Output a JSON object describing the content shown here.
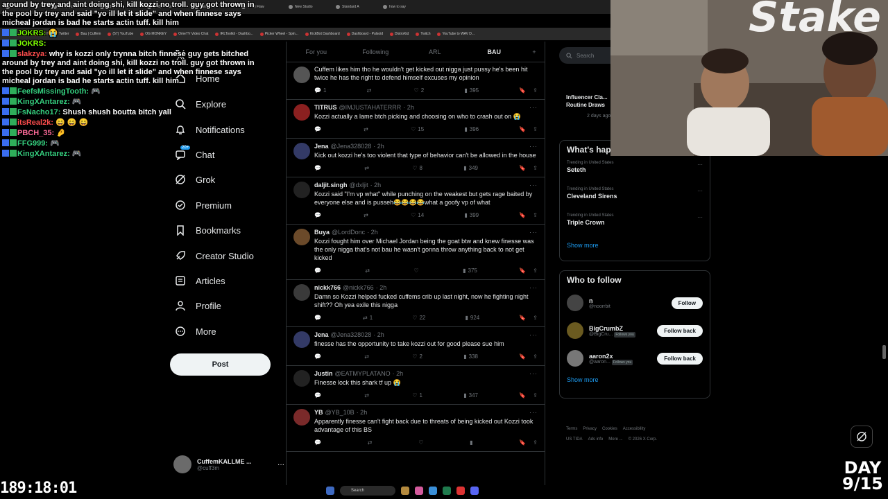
{
  "browser": {
    "tabs": [
      "IRLToolkit",
      "(439) ryzen",
      "(439) KickC",
      "(958) FREE",
      "konvy aunt",
      "(958) Flaw",
      "New Studio",
      "Standard A",
      "how to say"
    ],
    "bookmarks": [
      "(12) Home / Twitter",
      "Bau | Cuffem",
      "(57) YouTube",
      "OG MONKEY",
      "OmeTV Video Chat",
      "IRLToolkit - Dashbo...",
      "Picker Wheel - Spin...",
      "KickBot Dashboard",
      "Dashboard - Pulsoid",
      "DistroKid",
      "Twitch",
      "YouTube to WAV D..."
    ]
  },
  "chat": [
    {
      "user": "",
      "text": "around by trey and aint doing shi, kill kozzi no troll. guy got thrown in the pool by trey and said \"yo ill let it slide\" and when finnese says micheal jordan is bad he starts actin tuff. kill him"
    },
    {
      "user": "JOKRS:",
      "text": "😭"
    },
    {
      "user": "JOKRS:",
      "text": ""
    },
    {
      "user": "slakzya:",
      "text": "why is kozzi only trynna bitch finnese guy gets bitched around by trey and aint doing shi, kill kozzi no troll. guy got thrown in the pool by trey and said \"yo ill let it slide\" and when finnese says micheal jordan is bad he starts actin tuff. kill him"
    },
    {
      "user": "FeefsMissingTooth:",
      "text": "🎮"
    },
    {
      "user": "KingXAntarez:",
      "text": "🎮"
    },
    {
      "user": "FsNacho17:",
      "text": "Shush shush boutta bitch yall"
    },
    {
      "user": "itsReal2k:",
      "text": "😄 😄 😄"
    },
    {
      "user": "PBCH_35:",
      "text": "🤌"
    },
    {
      "user": "FFG999:",
      "text": "🎮"
    },
    {
      "user": "KingXAntarez:",
      "text": "🎮"
    }
  ],
  "nav": {
    "items": [
      {
        "label": "Home",
        "icon": "home-icon"
      },
      {
        "label": "Explore",
        "icon": "search-icon"
      },
      {
        "label": "Notifications",
        "icon": "bell-icon"
      },
      {
        "label": "Chat",
        "icon": "chat-icon",
        "badge": "20+"
      },
      {
        "label": "Grok",
        "icon": "grok-icon"
      },
      {
        "label": "Premium",
        "icon": "premium-icon"
      },
      {
        "label": "Bookmarks",
        "icon": "bookmark-icon"
      },
      {
        "label": "Creator Studio",
        "icon": "rocket-icon"
      },
      {
        "label": "Articles",
        "icon": "article-icon"
      },
      {
        "label": "Profile",
        "icon": "person-icon"
      },
      {
        "label": "More",
        "icon": "more-icon"
      }
    ],
    "post_label": "Post",
    "account": {
      "name": "CuffemKALLME ...",
      "handle": "@cuff3m"
    }
  },
  "feed": {
    "tabs": [
      "For you",
      "Following",
      "ARL",
      "BAU"
    ],
    "active_tab": "BAU",
    "tweets": [
      {
        "name": "",
        "handle": "",
        "time": "",
        "text": "Cuffem likes him tho he wouldn't get kicked out nigga just pussy he's been hit twice he has the right to defend himself excuses my opinion",
        "replies": "1",
        "reposts": "",
        "likes": "2",
        "views": "395"
      },
      {
        "name": "TITRUS",
        "handle": "@IMJUSTAHATERRR",
        "time": "· 2h",
        "text": "Kozzi actually a lame btch picking and choosing on who to crash out on 😭",
        "replies": "",
        "reposts": "",
        "likes": "15",
        "views": "396"
      },
      {
        "name": "Jena",
        "handle": "@Jena328028",
        "time": "· 2h",
        "text": "Kick out kozzi he's too violent that type of behavior can't be allowed in the house",
        "replies": "",
        "reposts": "",
        "likes": "8",
        "views": "349"
      },
      {
        "name": "daljit.singh",
        "handle": "@dxljit",
        "time": "· 2h",
        "text": "Kozzi said \"I'm vp what\" while punching on the weakest but gets rage baited by everyone else and is pusseh😂😂😂😂what a goofy vp of what",
        "replies": "",
        "reposts": "",
        "likes": "14",
        "views": "399"
      },
      {
        "name": "Buya",
        "handle": "@LordDonc",
        "time": "· 2h",
        "text": "Kozzi fought him over Michael Jordan being the goat btw and knew finesse was the only nigga that's not bau he wasn't gonna throw anything back to not get kicked",
        "replies": "",
        "reposts": "",
        "likes": "",
        "views": "375"
      },
      {
        "name": "nickk766",
        "handle": "@nickk766",
        "time": "· 2h",
        "text": "Damn so Kozzi helped fucked cuffems crib up last night, now he fighting night shift?? Oh yea exile this nigga",
        "replies": "",
        "reposts": "1",
        "likes": "22",
        "views": "924"
      },
      {
        "name": "Jena",
        "handle": "@Jena328028",
        "time": "· 2h",
        "text": "finesse has the opportunity to take kozzi out for good please sue him",
        "replies": "",
        "reposts": "",
        "likes": "2",
        "views": "338"
      },
      {
        "name": "Justin",
        "handle": "@EATMYPLATANO",
        "time": "· 2h",
        "text": "Finesse lock this shark tf up 😭",
        "replies": "",
        "reposts": "",
        "likes": "1",
        "views": "347"
      },
      {
        "name": "YB",
        "handle": "@YB_10B",
        "time": "· 2h",
        "text": "Apparently finesse can't fight back due to threats of being kicked out Kozzi took advantage of this BS",
        "replies": "",
        "reposts": "",
        "likes": "",
        "views": ""
      }
    ]
  },
  "right": {
    "search_placeholder": "Search",
    "live": {
      "title": "Influencer Cla... Routine Draws",
      "sub": "2 days ago"
    },
    "whats_happening_title": "What's hap",
    "trends": [
      {
        "context": "Trending in United States",
        "name": "Seteth"
      },
      {
        "context": "Trending in United States",
        "name": "Cleveland Sirens"
      },
      {
        "context": "Trending in United States",
        "name": "Triple Crown"
      }
    ],
    "show_more": "Show more",
    "who_to_follow_title": "Who to follow",
    "who_to_follow": [
      {
        "name": "n",
        "handle": "@noorrbit",
        "follows_you": "",
        "button": "Follow"
      },
      {
        "name": "BigCrumbZ",
        "handle": "@BigCru...",
        "follows_you": "Follows you",
        "button": "Follow back"
      },
      {
        "name": "aaron2x",
        "handle": "@aaron...",
        "follows_you": "Follows you",
        "button": "Follow back"
      }
    ],
    "show_more_2": "Show more",
    "footer": [
      "Terms",
      "Privacy",
      "Cookies",
      "Accessibility",
      "US TIDA",
      "Ads info",
      "More ...",
      "© 2026 X Corp."
    ]
  },
  "overlay": {
    "timer": "189:18:01",
    "day": "DAY",
    "day_count": "9/15",
    "stake": "Stake"
  },
  "taskbar": {
    "search": "Search"
  }
}
